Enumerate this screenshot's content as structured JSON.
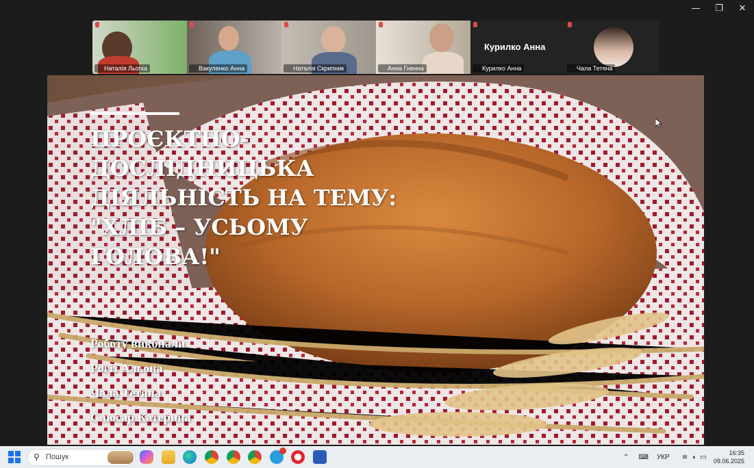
{
  "window": {
    "controls": [
      "—",
      "❐",
      "✕"
    ]
  },
  "participants": [
    {
      "name": "Наталія Льогка",
      "bg": "#7fa86a"
    },
    {
      "name": "Вакуленко Анна",
      "bg": "#9a8f86"
    },
    {
      "name": "Наталія Скрипник",
      "bg": "#b7b0a8"
    },
    {
      "name": "Анна Гненна",
      "bg": "#cfc7bb"
    },
    {
      "name": "Курилко Анна",
      "bg": "#232323",
      "big": "Курилко Анна"
    },
    {
      "name": "Чала Тетяна",
      "bg": "#232323"
    }
  ],
  "slide": {
    "title": "Проєктно-дослідницька діяльність на тему: \"Хліб – усьому голова!\"",
    "authors": [
      "Роботу виконали",
      "Рогіз Альона",
      "Чала Тетяна",
      "Слюсар Катерина"
    ]
  },
  "taskbar": {
    "search_placeholder": "Пошук",
    "language": "УКР",
    "time": "16:35",
    "date": "09.06.2025",
    "apps": [
      "copilot-icon",
      "file-explorer-icon",
      "edge-icon",
      "chrome-icon-1",
      "chrome-icon-2",
      "chrome-icon-3",
      "telegram-icon",
      "opera-icon",
      "word-icon"
    ]
  },
  "colors": {
    "mic_muted": "#e0484a",
    "accent": "#1a73e8"
  }
}
